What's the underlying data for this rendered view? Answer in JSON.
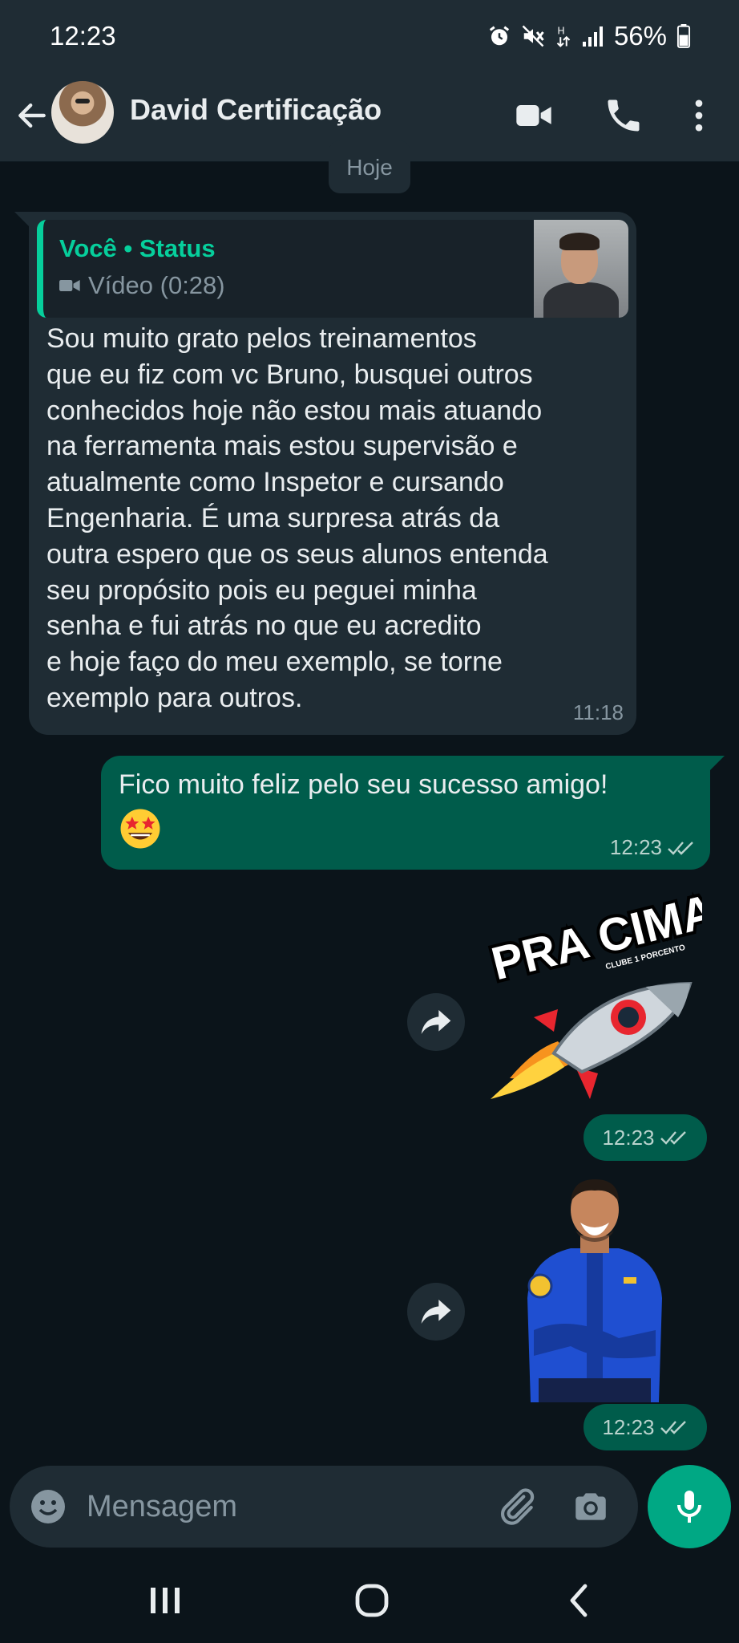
{
  "status_bar": {
    "time": "12:23",
    "battery": "56%"
  },
  "header": {
    "contact_name": "David Certificação"
  },
  "date_chip": "Hoje",
  "incoming_message": {
    "quote_author": "Você • Status",
    "quote_type": "Vídeo (0:28)",
    "text": "Sou muito grato pelos treinamentos\nque eu fiz com vc Bruno, busquei outros\nconhecidos hoje não estou mais atuando\nna ferramenta mais estou supervisão e\natualmente como Inspetor e cursando\nEngenharia. É uma surpresa atrás da\noutra espero que os seus alunos entenda\nseu propósito pois eu peguei minha\nsenha e fui atrás no que eu acredito\ne hoje faço do meu exemplo, se torne\nexemplo para outros.",
    "time": "11:18"
  },
  "outgoing_message": {
    "text": "Fico muito feliz pelo seu sucesso amigo!",
    "emoji": "star-struck-emoji",
    "time": "12:23"
  },
  "sticker_rocket": {
    "title": "PRA CIMAAA!",
    "subtitle": "CLUBE 1 PORCENTO",
    "time": "12:23"
  },
  "sticker_person": {
    "time": "12:23"
  },
  "composer": {
    "placeholder": "Mensagem"
  },
  "colors": {
    "accent": "#00a884",
    "outgoing_bubble": "#005c4b",
    "incoming_bubble": "#1f2c34",
    "quote_name": "#06cf9c"
  }
}
